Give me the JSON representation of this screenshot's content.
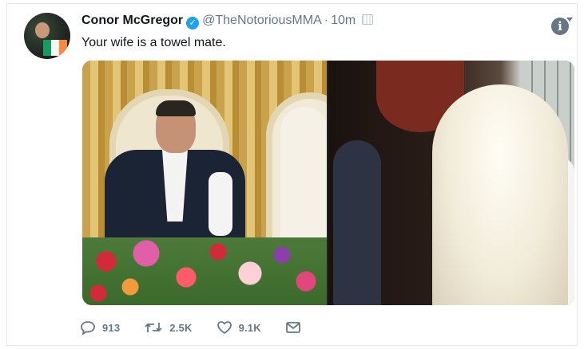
{
  "tweet": {
    "display_name": "Conor McGregor",
    "handle": "@TheNotoriousMMA",
    "separator": "·",
    "time": "10m",
    "text": "Your wife is a towel mate."
  },
  "actions": {
    "replies": "913",
    "retweets": "2.5K",
    "likes": "9.1K"
  },
  "colors": {
    "verified_badge": "#1da1f2",
    "secondary_text": "#657786"
  },
  "icons": {
    "verified": "verified-badge-icon",
    "info": "info-icon",
    "reply": "reply-icon",
    "retweet": "retweet-icon",
    "like": "like-icon",
    "message": "message-icon"
  }
}
